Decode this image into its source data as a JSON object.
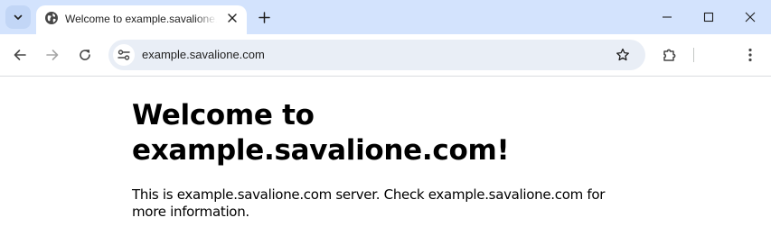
{
  "tab": {
    "title": "Welcome to example.savalione.com!",
    "favicon": "globe-icon"
  },
  "omnibox": {
    "url": "example.savalione.com"
  },
  "page": {
    "heading": "Welcome to example.savalione.com!",
    "body": "This is example.savalione.com server. Check example.savalione.com for more information."
  },
  "colors": {
    "tabstrip_bg": "#d3e3fd",
    "omnibox_bg": "#e9eef6",
    "icon": "#474747"
  }
}
